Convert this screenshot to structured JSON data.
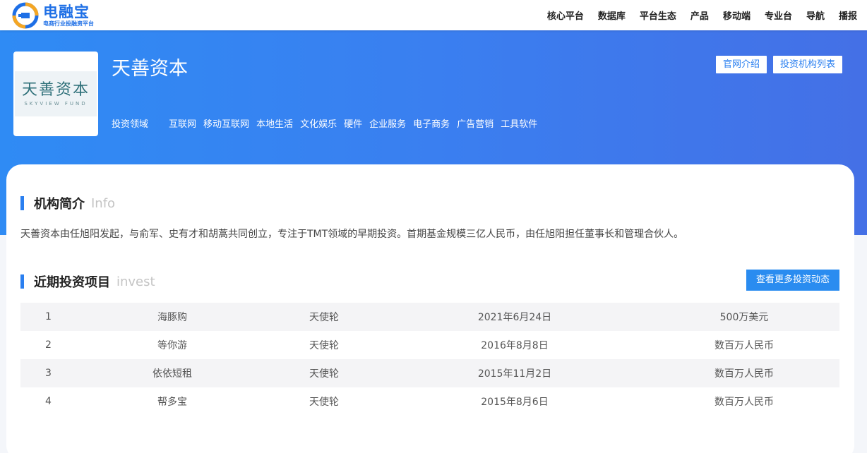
{
  "brand": {
    "title": "电融宝",
    "subtitle": "电商行业投融资平台"
  },
  "nav": [
    {
      "label": "核心平台"
    },
    {
      "label": "数据库"
    },
    {
      "label": "平台生态"
    },
    {
      "label": "产品"
    },
    {
      "label": "移动端"
    },
    {
      "label": "专业台"
    },
    {
      "label": "导航"
    },
    {
      "label": "播报"
    }
  ],
  "institution": {
    "name": "天善资本",
    "logo_cn": "天善资本",
    "logo_en": "SKYVIEW FUND",
    "field_label": "投资领域",
    "fields": [
      "互联网",
      "移动互联网",
      "本地生活",
      "文化娱乐",
      "硬件",
      "企业服务",
      "电子商务",
      "广告营销",
      "工具软件"
    ],
    "btn_intro": "官网介绍",
    "btn_list": "投资机构列表"
  },
  "intro_section": {
    "title": "机构简介",
    "en": "Info",
    "text": "天善资本由任旭阳发起，与俞军、史有才和胡蒿共同创立，专注于TMT领域的早期投资。首期基金规模三亿人民币，由任旭阳担任董事长和管理合伙人。"
  },
  "invest_section": {
    "title": "近期投资项目",
    "en": "invest",
    "more": "查看更多投资动态",
    "rows": [
      {
        "idx": "1",
        "name": "海豚购",
        "round": "天使轮",
        "date": "2021年6月24日",
        "amount": "500万美元"
      },
      {
        "idx": "2",
        "name": "等你游",
        "round": "天使轮",
        "date": "2016年8月8日",
        "amount": "数百万人民币"
      },
      {
        "idx": "3",
        "name": "依依短租",
        "round": "天使轮",
        "date": "2015年11月2日",
        "amount": "数百万人民币"
      },
      {
        "idx": "4",
        "name": "帮多宝",
        "round": "天使轮",
        "date": "2015年8月6日",
        "amount": "数百万人民币"
      }
    ]
  },
  "colors": {
    "brand_blue": "#1e6fe6",
    "hero_start": "#2f8bf4",
    "hero_end": "#4470e6",
    "accent": "#2a7ff0"
  }
}
